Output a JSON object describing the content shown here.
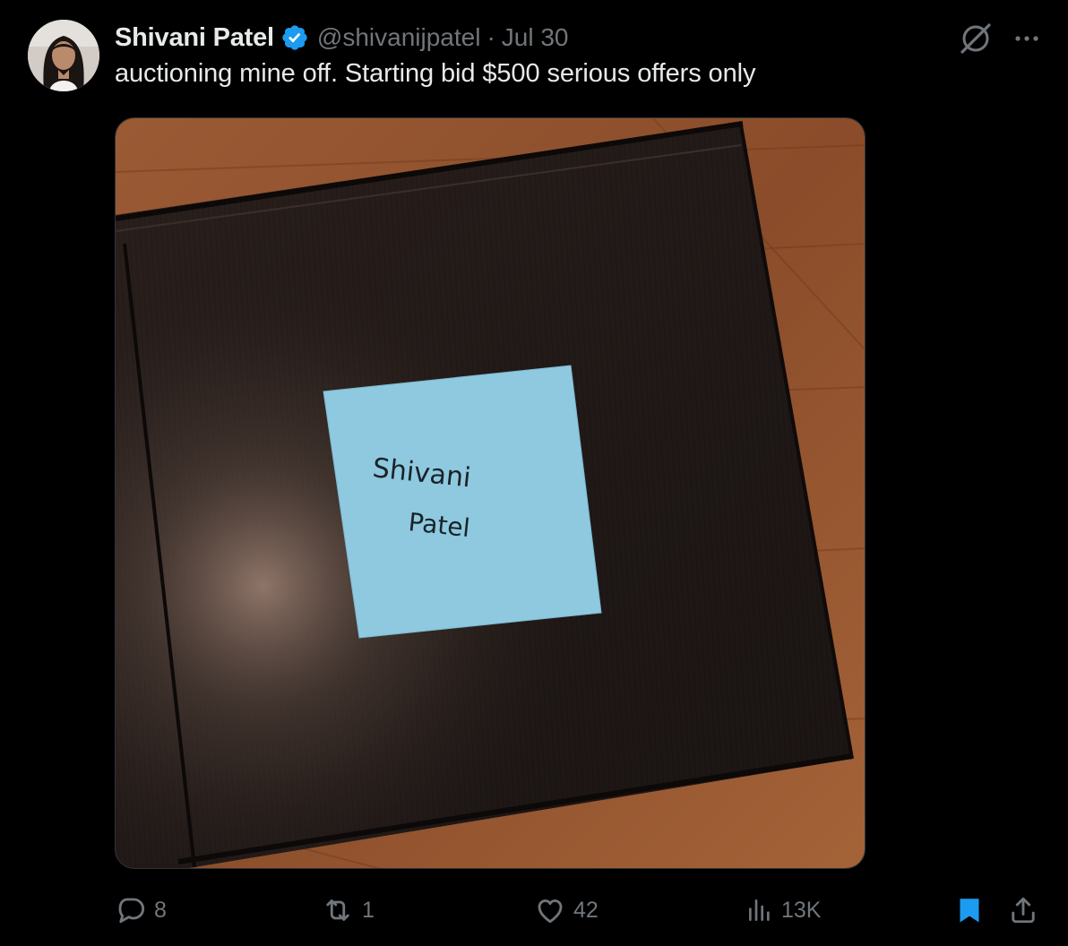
{
  "author": {
    "display_name": "Shivani Patel",
    "handle": "@shivanijpatel",
    "separator": "·",
    "date": "Jul 30",
    "verified": true
  },
  "tweet": {
    "text": "auctioning mine off. Starting bid $500 serious offers only"
  },
  "media": {
    "note_line1": "Shivani",
    "note_line2": "Patel"
  },
  "actions": {
    "replies": "8",
    "reposts": "1",
    "likes": "42",
    "views": "13K"
  },
  "colors": {
    "background": "#000000",
    "text_primary": "#e7e9ea",
    "text_secondary": "#71767b",
    "accent": "#1d9bf0",
    "sticky_note": "#8ec9df"
  },
  "icons": {
    "verified": "verified-badge-icon",
    "grok": "grok-icon",
    "more": "more-icon",
    "reply": "reply-icon",
    "repost": "repost-icon",
    "like": "like-icon",
    "views": "views-icon",
    "bookmark": "bookmark-icon",
    "share": "share-icon"
  }
}
